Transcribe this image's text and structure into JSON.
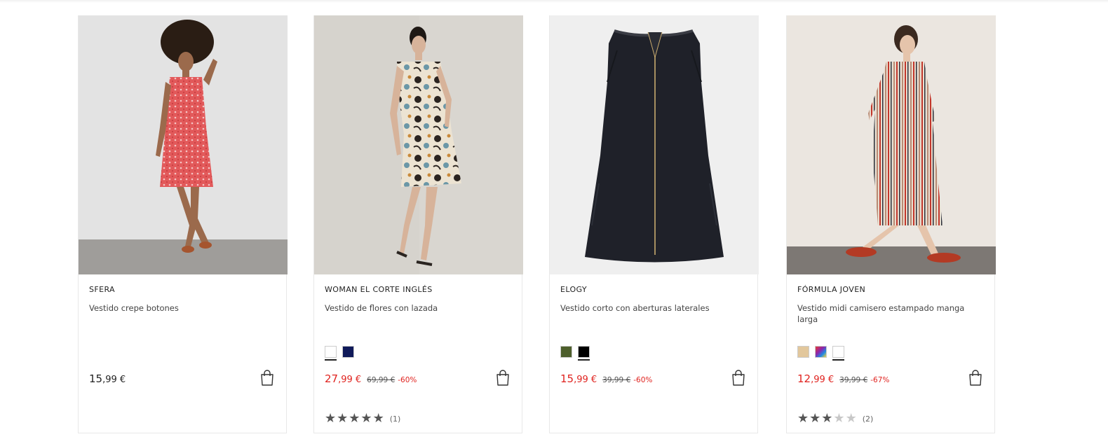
{
  "products": [
    {
      "brand": "SFERA",
      "title": "Vestido crepe botones",
      "price_int": "15",
      "price_dec": ",99 €",
      "sale": false,
      "old_price": "",
      "discount": "",
      "swatches": [],
      "rating": null,
      "reviews": "",
      "image_icon": "model-red-floral-dress"
    },
    {
      "brand": "WOMAN EL CORTE INGLÉS",
      "title": "Vestido de flores con lazada",
      "price_int": "27",
      "price_dec": ",99 €",
      "sale": true,
      "old_price": "69,99 €",
      "discount": "-60%",
      "swatches": [
        {
          "color": "#ffffff",
          "selected": true
        },
        {
          "color": "#101a5a",
          "selected": false
        }
      ],
      "rating": 5,
      "reviews": "(1)",
      "image_icon": "model-floral-wrap-dress"
    },
    {
      "brand": "ELOGY",
      "title": "Vestido corto con aberturas laterales",
      "price_int": "15",
      "price_dec": ",99 €",
      "sale": true,
      "old_price": "39,99 €",
      "discount": "-60%",
      "swatches": [
        {
          "color": "#4d5f2c",
          "selected": false
        },
        {
          "color": "#000000",
          "selected": true
        }
      ],
      "rating": null,
      "reviews": "",
      "image_icon": "black-sleeveless-dress"
    },
    {
      "brand": "FÓRMULA JOVEN",
      "title": "Vestido midi camisero estampado manga larga",
      "price_int": "12",
      "price_dec": ",99 €",
      "sale": true,
      "old_price": "39,99 €",
      "discount": "-67%",
      "swatches": [
        {
          "color": "#e2c79c",
          "selected": false
        },
        {
          "color": "multicolor",
          "selected": false
        },
        {
          "color": "#ffffff",
          "selected": true
        }
      ],
      "rating": 3,
      "reviews": "(2)",
      "image_icon": "model-striped-shirt-dress"
    }
  ],
  "colors": {
    "sale_red": "#e0231f",
    "text_dark": "#222222",
    "star_on": "#555555",
    "star_off": "#c8c8c8"
  },
  "icons": {
    "cart": "shopping-bag-icon",
    "star": "star-icon"
  }
}
